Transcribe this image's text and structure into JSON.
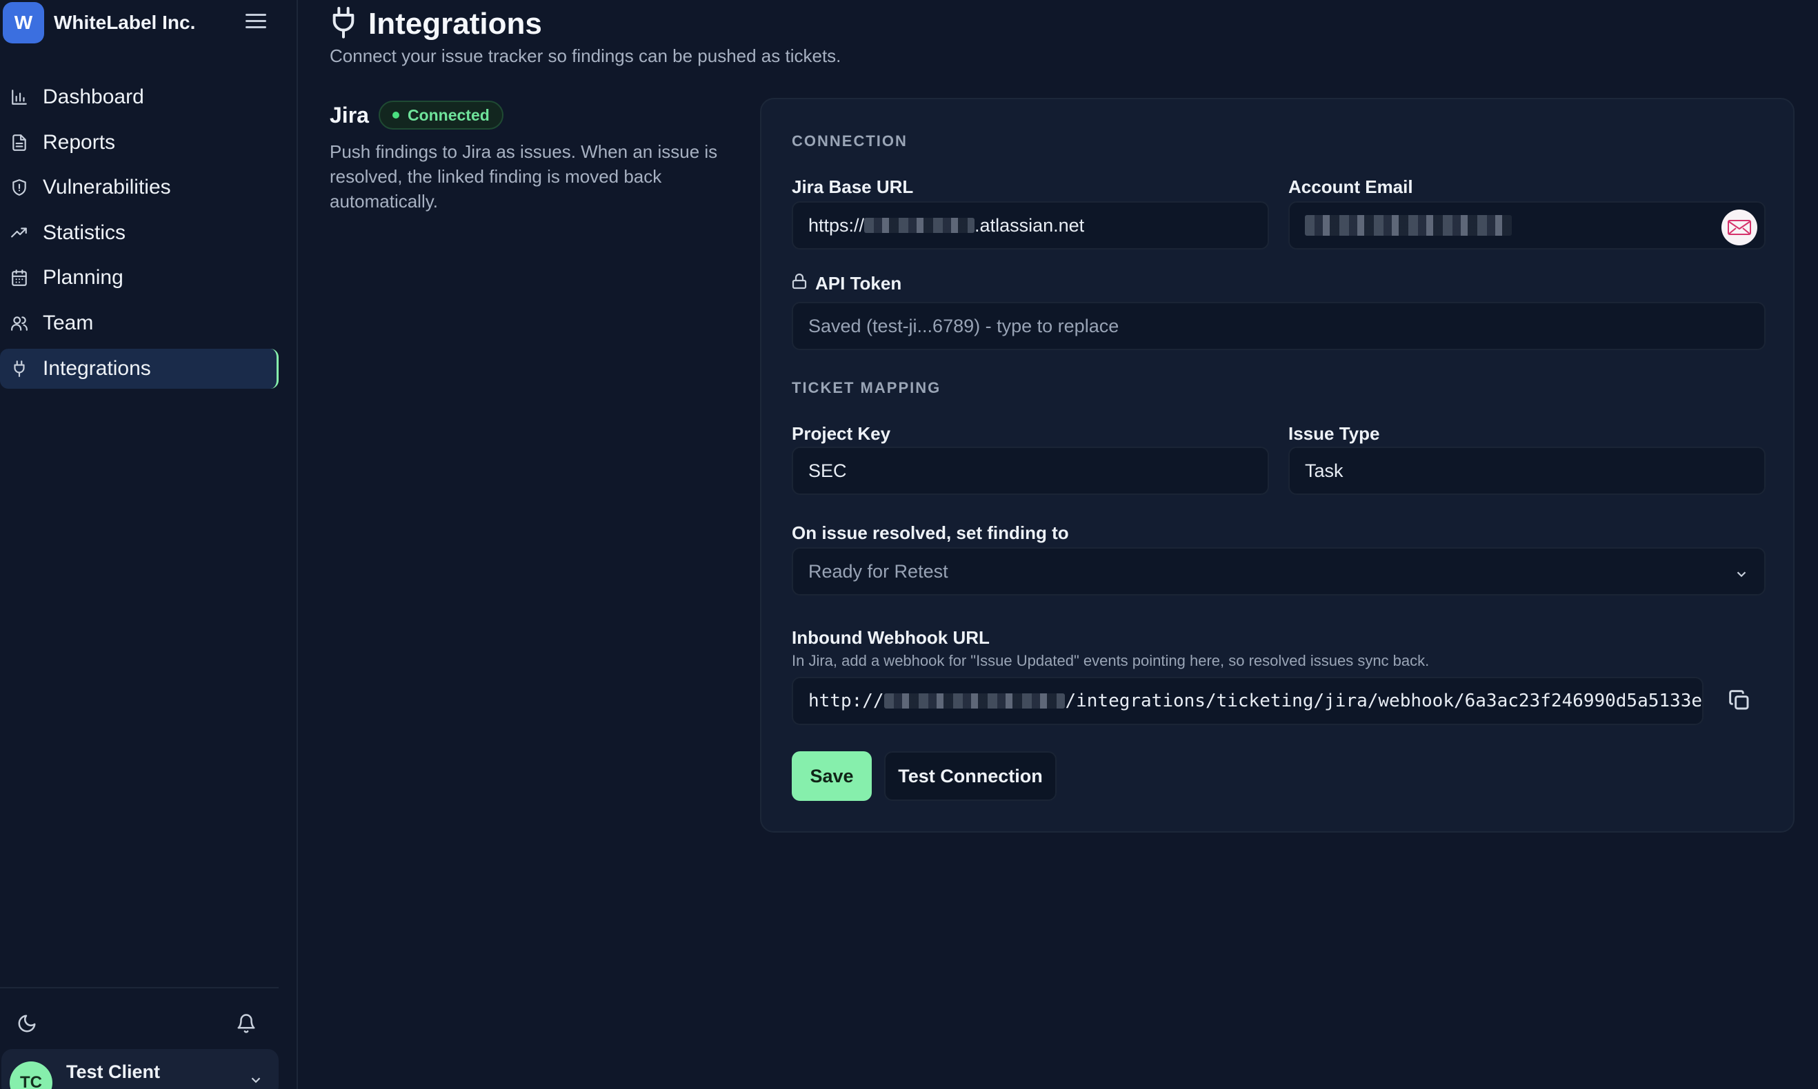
{
  "brand": {
    "logo_letter": "W",
    "name": "WhiteLabel Inc."
  },
  "sidebar": {
    "items": [
      {
        "label": "Dashboard",
        "icon": "bar-chart-icon"
      },
      {
        "label": "Reports",
        "icon": "document-icon"
      },
      {
        "label": "Vulnerabilities",
        "icon": "shield-icon"
      },
      {
        "label": "Statistics",
        "icon": "trend-up-icon"
      },
      {
        "label": "Planning",
        "icon": "calendar-icon"
      },
      {
        "label": "Team",
        "icon": "users-icon"
      },
      {
        "label": "Integrations",
        "icon": "plug-icon",
        "active": true
      }
    ]
  },
  "user": {
    "initials": "TC",
    "name": "Test Client"
  },
  "header": {
    "title": "Integrations",
    "subtitle": "Connect your issue tracker so findings can be pushed as tickets."
  },
  "jira": {
    "title": "Jira",
    "status": "Connected",
    "description": "Push findings to Jira as issues. When an issue is resolved, the linked finding is moved back automatically."
  },
  "connection": {
    "section_label": "CONNECTION",
    "base_url_label": "Jira Base URL",
    "base_url_prefix": "https://",
    "base_url_suffix": ".atlassian.net",
    "email_label": "Account Email",
    "token_label": "API Token",
    "token_placeholder": "Saved (test-ji...6789) - type to replace"
  },
  "mapping": {
    "section_label": "TICKET MAPPING",
    "project_key_label": "Project Key",
    "project_key_value": "SEC",
    "issue_type_label": "Issue Type",
    "issue_type_value": "Task",
    "resolved_label": "On issue resolved, set finding to",
    "resolved_value": "Ready for Retest"
  },
  "webhook": {
    "label": "Inbound Webhook URL",
    "helper": "In Jira, add a webhook for \"Issue Updated\" events pointing here, so resolved issues sync back.",
    "url_prefix": "http://",
    "url_suffix": "/integrations/ticketing/jira/webhook/6a3ac23f246990d5a5133e"
  },
  "actions": {
    "save_label": "Save",
    "test_label": "Test Connection"
  },
  "colors": {
    "accent": "#86efac",
    "brand": "#3b6fe0",
    "background": "#0f1729",
    "status_connected": "#4ade80"
  }
}
